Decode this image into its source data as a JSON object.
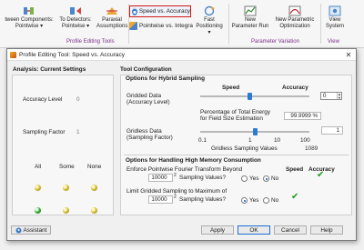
{
  "ribbon": {
    "group_labels": {
      "profile_editing": "Profile Editing Tools",
      "parameter_variation": "Parameter Variation",
      "view": "View"
    },
    "items": {
      "between_components": "tween Components:",
      "between_components_sub": "Pointwise ▾",
      "to_detectors": "To Detectors:",
      "to_detectors_sub": "Pointwise ▾",
      "paraxial": "Paraxial",
      "paraxial_sub": "Assumptions",
      "speed_vs_accuracy": "Speed vs. Accuracy",
      "pointwise_vs_integral": "Pointwise vs. Integra",
      "fast_positioning": "Fast",
      "fast_positioning_sub": "Positioning ▾",
      "new_parameter_run": "New",
      "new_parameter_run_sub": "Parameter Run",
      "new_parametric_opt": "New Parametric",
      "new_parametric_opt_sub": "Optimization",
      "view_system": "View",
      "view_system_sub": "System"
    }
  },
  "dialog": {
    "title": "Profile Editing Tool: Speed vs. Accuracy",
    "close_glyph": "✕",
    "analysis": {
      "heading": "Analysis: Current Settings",
      "accuracy_label": "Accuracy Level",
      "accuracy_value": "0",
      "sampling_label": "Sampling Factor",
      "sampling_value": "1",
      "col_all": "All",
      "col_some": "Some",
      "col_none": "None"
    },
    "config": {
      "heading": "Tool Configuration",
      "hybrid_heading": "Options for Hybrid Sampling",
      "speed_header": "Speed",
      "accuracy_header": "Accuracy",
      "gridded_label": "Gridded Data",
      "gridded_sub": "(Accuracy Level)",
      "gridded_spin": "0",
      "energy_label": "Percentage of Total Energy",
      "energy_label2": "for Field Size Estimation",
      "energy_value": "99.9999 %",
      "gridless_label": "Gridless Data",
      "gridless_sub": "(Sampling Factor)",
      "gridless_field": "1",
      "scale": [
        "0.1",
        "1",
        "10",
        "100"
      ],
      "gridless_values_label": "Gridless Sampling Values",
      "gridless_values": "1089",
      "memory_heading": "Options for Handling High Memory Consumption",
      "mem_speed": "Speed",
      "mem_accuracy": "Accuracy",
      "enforce_label": "Enforce Pointwise Fourier Transform Beyond",
      "enforce_value": "10000",
      "enforce_unit": "Sampling Values?",
      "enforce_exp": "2",
      "limit_label": "Limit Gridded Sampling to Maximum of",
      "limit_value": "10000",
      "limit_unit": "Sampling Values?",
      "limit_exp": "2",
      "yes": "Yes",
      "no": "No"
    },
    "footer": {
      "assistant": "Assistant",
      "apply": "Apply",
      "ok": "OK",
      "cancel": "Cancel",
      "help": "Help"
    }
  }
}
